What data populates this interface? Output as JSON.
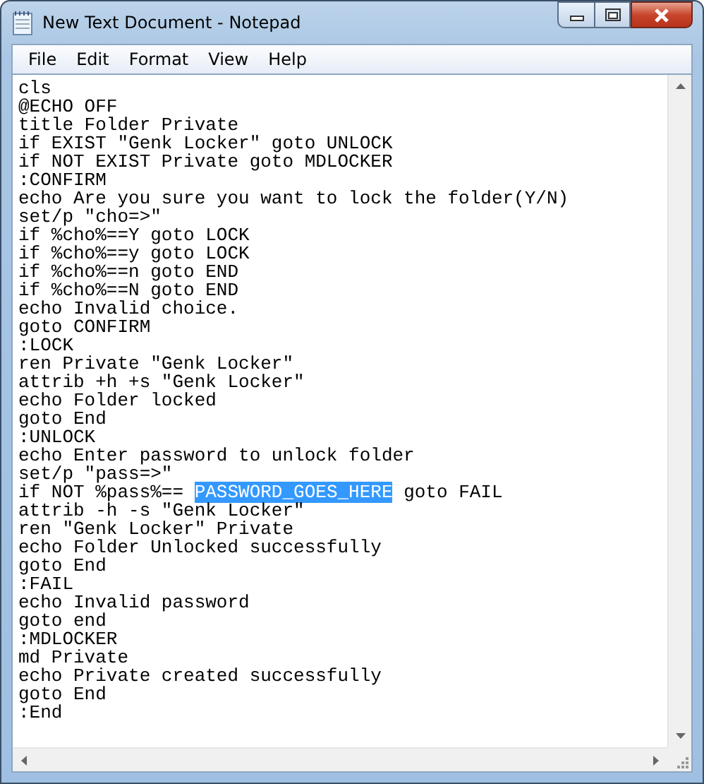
{
  "window": {
    "title": "New Text Document - Notepad"
  },
  "menu": [
    "File",
    "Edit",
    "Format",
    "View",
    "Help"
  ],
  "editor": {
    "lines": [
      "cls",
      "@ECHO OFF",
      "title Folder Private",
      "if EXIST \"Genk Locker\" goto UNLOCK",
      "if NOT EXIST Private goto MDLOCKER",
      ":CONFIRM",
      "echo Are you sure you want to lock the folder(Y/N)",
      "set/p \"cho=>\"",
      "if %cho%==Y goto LOCK",
      "if %cho%==y goto LOCK",
      "if %cho%==n goto END",
      "if %cho%==N goto END",
      "echo Invalid choice.",
      "goto CONFIRM",
      ":LOCK",
      "ren Private \"Genk Locker\"",
      "attrib +h +s \"Genk Locker\"",
      "echo Folder locked",
      "goto End",
      ":UNLOCK",
      "echo Enter password to unlock folder",
      "set/p \"pass=>\"",
      {
        "segments": [
          {
            "text": "if NOT %pass%== ",
            "selected": false
          },
          {
            "text": "PASSWORD_GOES_HERE",
            "selected": true
          },
          {
            "text": " goto FAIL",
            "selected": false
          }
        ]
      },
      "attrib -h -s \"Genk Locker\"",
      "ren \"Genk Locker\" Private",
      "echo Folder Unlocked successfully",
      "goto End",
      ":FAIL",
      "echo Invalid password",
      "goto end",
      ":MDLOCKER",
      "md Private",
      "echo Private created successfully",
      "goto End",
      ":End"
    ]
  }
}
